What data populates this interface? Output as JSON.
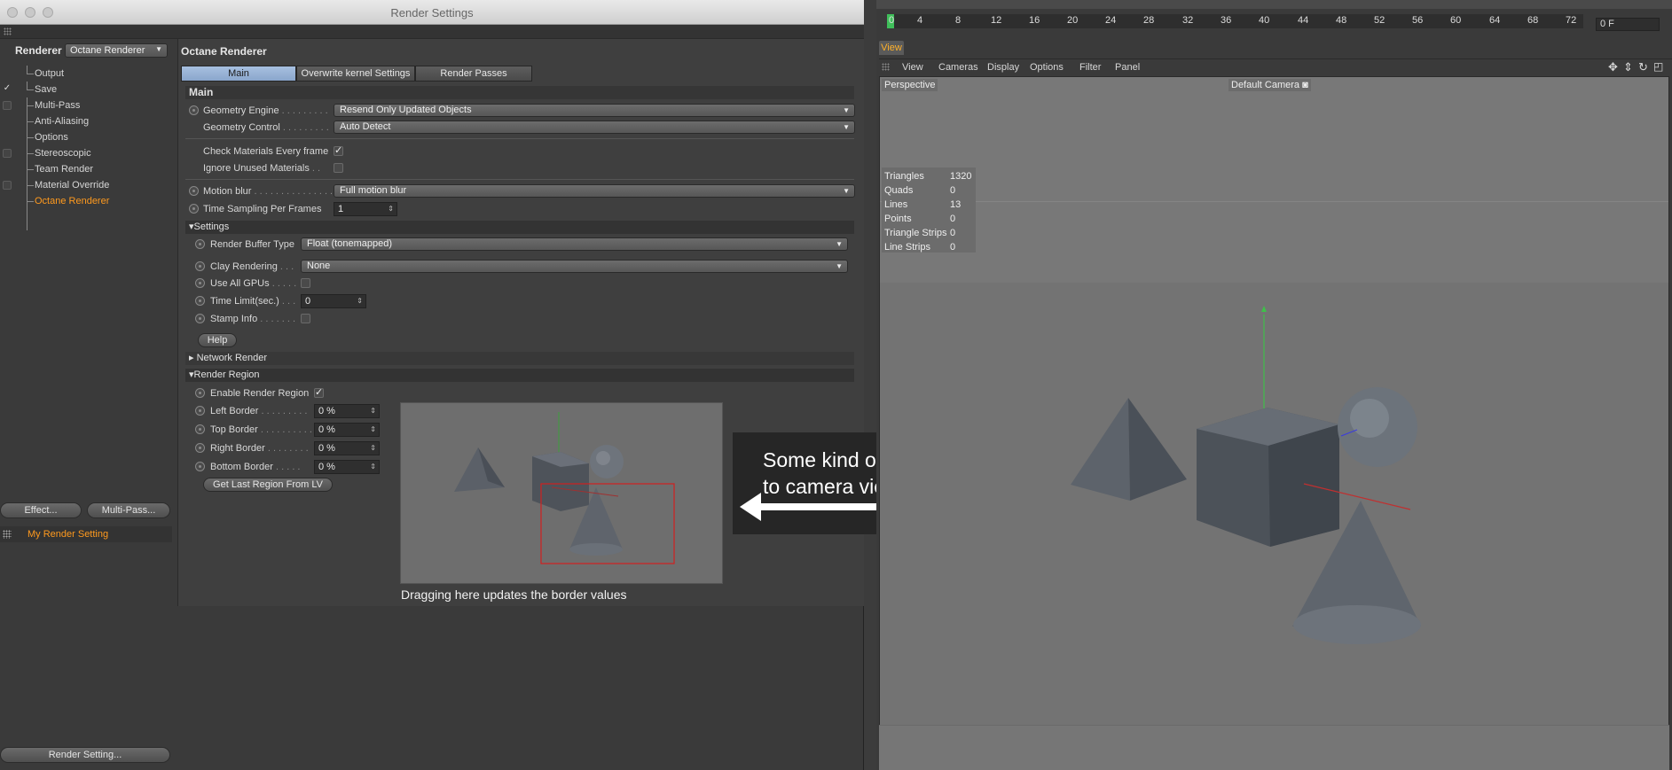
{
  "window": {
    "title": "Render Settings"
  },
  "nav": {
    "renderer_label": "Renderer",
    "renderer_value": "Octane Renderer",
    "items": [
      {
        "label": "Output",
        "checked": false,
        "has_box": false
      },
      {
        "label": "Save",
        "checked": true,
        "has_box": false
      },
      {
        "label": "Multi-Pass",
        "checked": false,
        "has_box": true
      },
      {
        "label": "Anti-Aliasing",
        "checked": false,
        "has_box": false
      },
      {
        "label": "Options",
        "checked": false,
        "has_box": false
      },
      {
        "label": "Stereoscopic",
        "checked": false,
        "has_box": true
      },
      {
        "label": "Team Render",
        "checked": false,
        "has_box": false
      },
      {
        "label": "Material Override",
        "checked": false,
        "has_box": true
      },
      {
        "label": "Octane Renderer",
        "checked": false,
        "has_box": false,
        "active": true
      }
    ],
    "effect_button": "Effect...",
    "multipass_button": "Multi-Pass...",
    "render_setting_name": "My Render Setting",
    "render_setting_button": "Render Setting..."
  },
  "panel": {
    "title": "Octane Renderer",
    "tabs": [
      "Main",
      "Overwrite kernel Settings",
      "Render Passes"
    ],
    "main_header": "Main",
    "geometry_engine_label": "Geometry Engine",
    "geometry_engine_value": "Resend Only Updated Objects",
    "geometry_control_label": "Geometry Control",
    "geometry_control_value": "Auto Detect",
    "check_materials_label": "Check Materials Every frame",
    "ignore_unused_label": "Ignore Unused Materials",
    "motion_blur_label": "Motion blur",
    "motion_blur_value": "Full motion blur",
    "time_sampling_label": "Time Sampling Per Frames",
    "time_sampling_value": "1",
    "settings_header": "Settings",
    "render_buffer_label": "Render Buffer Type",
    "render_buffer_value": "Float (tonemapped)",
    "clay_label": "Clay Rendering",
    "clay_value": "None",
    "all_gpus_label": "Use All GPUs",
    "time_limit_label": "Time Limit(sec.)",
    "time_limit_value": "0",
    "stamp_label": "Stamp Info",
    "help_button": "Help",
    "network_header": "Network Render",
    "region_header": "Render Region",
    "enable_region_label": "Enable Render Region",
    "left_border_label": "Left Border",
    "left_border_value": "0 %",
    "top_border_label": "Top Border",
    "top_border_value": "0 %",
    "right_border_label": "Right Border",
    "right_border_value": "0 %",
    "bottom_border_label": "Bottom Border",
    "bottom_border_value": "0 %",
    "last_region_button": "Get Last Region From LV",
    "preview_caption": "Dragging here updates the border values"
  },
  "callout": {
    "line1": "Some kind of reference",
    "line2": "to camera view"
  },
  "timeline": {
    "ticks": [
      "0",
      "4",
      "8",
      "12",
      "16",
      "20",
      "24",
      "28",
      "32",
      "36",
      "40",
      "44",
      "48",
      "52",
      "56",
      "60",
      "64",
      "68",
      "72"
    ],
    "frame_value": "0 F"
  },
  "viewport": {
    "tab": "View",
    "menu": [
      "View",
      "Cameras",
      "Display",
      "Options",
      "Filter",
      "Panel"
    ],
    "perspective_label": "Perspective",
    "camera_label": "Default Camera",
    "stats": [
      {
        "label": "Triangles",
        "value": "1320"
      },
      {
        "label": "Quads",
        "value": "0"
      },
      {
        "label": "Lines",
        "value": "13"
      },
      {
        "label": "Points",
        "value": "0"
      },
      {
        "label": "Triangle Strips",
        "value": "0"
      },
      {
        "label": "Line Strips",
        "value": "0"
      }
    ]
  },
  "colors": {
    "accent_orange": "#ff9a1e",
    "tab_selected": "#8aa6cc",
    "region_rect": "#d02020"
  }
}
